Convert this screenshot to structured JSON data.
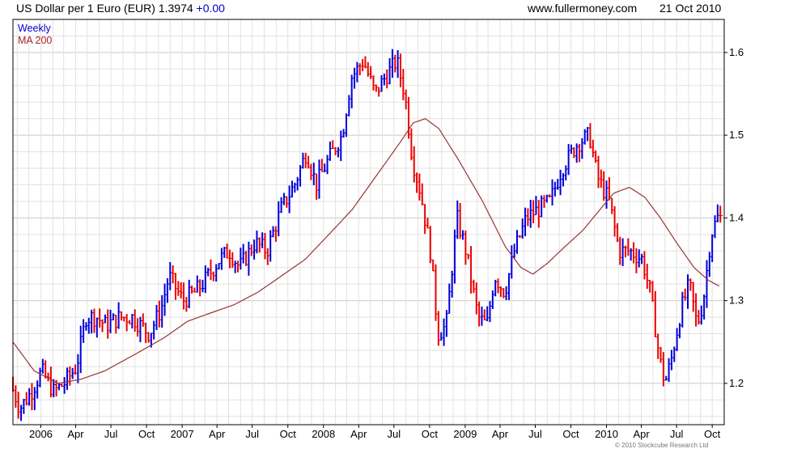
{
  "header": {
    "instrument": "US Dollar per 1 Euro (EUR)",
    "last": "1.3974",
    "change": "+0.00",
    "website": "www.fullermoney.com",
    "date": "21 Oct 2010"
  },
  "legend": {
    "weekly_label": "Weekly",
    "ma_label": "MA 200"
  },
  "footer": {
    "copyright": "© 2010 Stockcube Research Ltd"
  },
  "colors": {
    "up_bar": "#0000dd",
    "down_bar": "#ee0000",
    "moving_average": "#993333",
    "grid": "#e2e2e2",
    "axis": "#000000"
  },
  "chart_data": {
    "type": "ohlc_bar",
    "frequency": "weekly",
    "y_axis_position": "right",
    "ylim": [
      1.15,
      1.64
    ],
    "y_ticks": [
      1.2,
      1.3,
      1.4,
      1.5,
      1.6
    ],
    "y_tick_labels": [
      "1.2",
      "1.3",
      "1.4",
      "1.5",
      "1.6"
    ],
    "x_range": [
      "2005-10-21",
      "2010-11-01"
    ],
    "x_ticks": [
      {
        "date": "2006-01-01",
        "label": "2006"
      },
      {
        "date": "2006-04-01",
        "label": "Apr"
      },
      {
        "date": "2006-07-01",
        "label": "Jul"
      },
      {
        "date": "2006-10-01",
        "label": "Oct"
      },
      {
        "date": "2007-01-01",
        "label": "2007"
      },
      {
        "date": "2007-04-01",
        "label": "Apr"
      },
      {
        "date": "2007-07-01",
        "label": "Jul"
      },
      {
        "date": "2007-10-01",
        "label": "Oct"
      },
      {
        "date": "2008-01-01",
        "label": "2008"
      },
      {
        "date": "2008-04-01",
        "label": "Apr"
      },
      {
        "date": "2008-07-01",
        "label": "Jul"
      },
      {
        "date": "2008-10-01",
        "label": "Oct"
      },
      {
        "date": "2009-01-01",
        "label": "2009"
      },
      {
        "date": "2009-04-01",
        "label": "Apr"
      },
      {
        "date": "2009-07-01",
        "label": "Jul"
      },
      {
        "date": "2009-10-01",
        "label": "Oct"
      },
      {
        "date": "2010-01-01",
        "label": "2010"
      },
      {
        "date": "2010-04-01",
        "label": "Apr"
      },
      {
        "date": "2010-07-01",
        "label": "Jul"
      },
      {
        "date": "2010-10-01",
        "label": "Oct"
      }
    ],
    "grid": true,
    "legend_position": "top-left",
    "price_path": [
      [
        "2005-10-21",
        1.2
      ],
      [
        "2005-11-15",
        1.17
      ],
      [
        "2005-12-15",
        1.19
      ],
      [
        "2006-01-10",
        1.215
      ],
      [
        "2006-02-10",
        1.19
      ],
      [
        "2006-03-10",
        1.2
      ],
      [
        "2006-04-10",
        1.22
      ],
      [
        "2006-05-05",
        1.28
      ],
      [
        "2006-06-01",
        1.28
      ],
      [
        "2006-06-25",
        1.27
      ],
      [
        "2006-08-01",
        1.28
      ],
      [
        "2006-09-01",
        1.28
      ],
      [
        "2006-10-15",
        1.26
      ],
      [
        "2006-11-15",
        1.29
      ],
      [
        "2006-12-05",
        1.33
      ],
      [
        "2007-01-10",
        1.3
      ],
      [
        "2007-02-10",
        1.31
      ],
      [
        "2007-03-01",
        1.32
      ],
      [
        "2007-04-15",
        1.35
      ],
      [
        "2007-05-10",
        1.36
      ],
      [
        "2007-06-05",
        1.34
      ],
      [
        "2007-07-15",
        1.37
      ],
      [
        "2007-08-15",
        1.36
      ],
      [
        "2007-09-20",
        1.41
      ],
      [
        "2007-10-25",
        1.44
      ],
      [
        "2007-11-25",
        1.48
      ],
      [
        "2007-12-20",
        1.44
      ],
      [
        "2008-01-20",
        1.47
      ],
      [
        "2008-02-25",
        1.5
      ],
      [
        "2008-03-20",
        1.57
      ],
      [
        "2008-04-20",
        1.59
      ],
      [
        "2008-05-20",
        1.55
      ],
      [
        "2008-06-15",
        1.57
      ],
      [
        "2008-07-15",
        1.59
      ],
      [
        "2008-08-05",
        1.55
      ],
      [
        "2008-08-25",
        1.47
      ],
      [
        "2008-09-15",
        1.43
      ],
      [
        "2008-10-10",
        1.36
      ],
      [
        "2008-10-30",
        1.26
      ],
      [
        "2008-11-20",
        1.27
      ],
      [
        "2008-12-18",
        1.4
      ],
      [
        "2009-01-10",
        1.36
      ],
      [
        "2009-02-10",
        1.28
      ],
      [
        "2009-03-05",
        1.27
      ],
      [
        "2009-03-25",
        1.33
      ],
      [
        "2009-04-20",
        1.31
      ],
      [
        "2009-05-15",
        1.36
      ],
      [
        "2009-06-15",
        1.4
      ],
      [
        "2009-07-15",
        1.41
      ],
      [
        "2009-08-15",
        1.42
      ],
      [
        "2009-09-15",
        1.46
      ],
      [
        "2009-10-25",
        1.49
      ],
      [
        "2009-11-25",
        1.5
      ],
      [
        "2009-12-15",
        1.45
      ],
      [
        "2010-01-15",
        1.42
      ],
      [
        "2010-02-10",
        1.36
      ],
      [
        "2010-03-10",
        1.36
      ],
      [
        "2010-04-10",
        1.35
      ],
      [
        "2010-05-01",
        1.31
      ],
      [
        "2010-05-25",
        1.23
      ],
      [
        "2010-06-08",
        1.2
      ],
      [
        "2010-06-25",
        1.23
      ],
      [
        "2010-07-20",
        1.29
      ],
      [
        "2010-08-10",
        1.32
      ],
      [
        "2010-08-30",
        1.27
      ],
      [
        "2010-09-15",
        1.3
      ],
      [
        "2010-10-05",
        1.38
      ],
      [
        "2010-10-21",
        1.4
      ]
    ],
    "moving_average_path": [
      [
        "2005-10-21",
        1.25
      ],
      [
        "2005-12-15",
        1.215
      ],
      [
        "2006-02-15",
        1.2
      ],
      [
        "2006-04-15",
        1.205
      ],
      [
        "2006-06-15",
        1.215
      ],
      [
        "2006-09-01",
        1.235
      ],
      [
        "2006-11-15",
        1.255
      ],
      [
        "2007-01-15",
        1.275
      ],
      [
        "2007-03-15",
        1.285
      ],
      [
        "2007-05-15",
        1.295
      ],
      [
        "2007-07-15",
        1.31
      ],
      [
        "2007-09-15",
        1.33
      ],
      [
        "2007-11-15",
        1.35
      ],
      [
        "2008-01-15",
        1.38
      ],
      [
        "2008-03-15",
        1.41
      ],
      [
        "2008-05-15",
        1.45
      ],
      [
        "2008-07-15",
        1.49
      ],
      [
        "2008-08-20",
        1.515
      ],
      [
        "2008-09-20",
        1.52
      ],
      [
        "2008-10-25",
        1.508
      ],
      [
        "2008-12-15",
        1.47
      ],
      [
        "2009-02-15",
        1.42
      ],
      [
        "2009-04-15",
        1.365
      ],
      [
        "2009-05-25",
        1.34
      ],
      [
        "2009-06-25",
        1.332
      ],
      [
        "2009-08-01",
        1.345
      ],
      [
        "2009-09-15",
        1.365
      ],
      [
        "2009-11-01",
        1.385
      ],
      [
        "2009-12-15",
        1.41
      ],
      [
        "2010-01-20",
        1.43
      ],
      [
        "2010-03-01",
        1.437
      ],
      [
        "2010-04-10",
        1.425
      ],
      [
        "2010-05-20",
        1.4
      ],
      [
        "2010-07-01",
        1.37
      ],
      [
        "2010-08-15",
        1.34
      ],
      [
        "2010-09-20",
        1.325
      ],
      [
        "2010-10-21",
        1.317
      ]
    ]
  }
}
